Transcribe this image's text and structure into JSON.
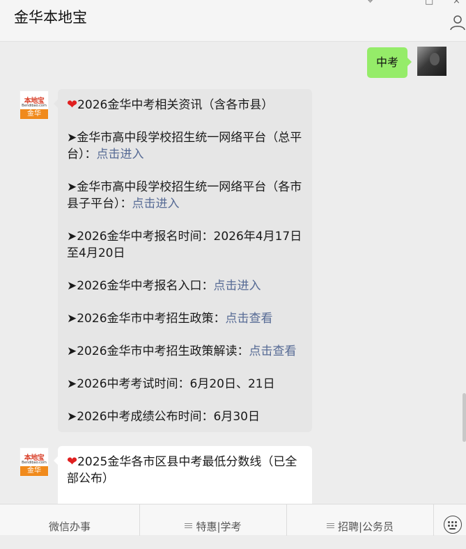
{
  "header": {
    "title": "金华本地宝",
    "pin_glyph": "⌖",
    "max_glyph": "□",
    "close_glyph": "×"
  },
  "messages": {
    "me": {
      "text": "中考"
    },
    "bot_avatar": {
      "top": "本地宝",
      "url": "Bendibao.com",
      "band": "金华"
    },
    "msg1": {
      "heart": "❤",
      "title": "2026金华中考相关资讯（含各市县）",
      "line1_text": "➤金华市高中段学校招生统一网络平台（总平台）：",
      "line1_link": "点击进入",
      "line2_text": "➤金华市高中段学校招生统一网络平台（各市县子平台）：",
      "line2_link": "点击进入",
      "line3_text": "➤2026金华中考报名时间：2026年4月17日至4月20日",
      "line4_text": "➤2026金华中考报名入口：",
      "line4_link": "点击进入",
      "line5_text": "➤2026金华市中考招生政策：",
      "line5_link": "点击查看",
      "line6_text": "➤2026金华市中考招生政策解读：",
      "line6_link": "点击查看",
      "line7_text": "➤2026中考考试时间：6月20日、21日",
      "line8_text": "➤2026中考成绩公布时间：6月30日"
    },
    "msg2": {
      "heart": "❤",
      "title": "2025金华各市区县中考最低分数线（已全部公布）"
    }
  },
  "bottom_menu": {
    "tab1": "微信办事",
    "tab2": "特惠|学考",
    "tab3": "招聘|公务员"
  },
  "icons": {
    "profile": "person-icon",
    "keyboard": "keyboard-icon",
    "menu": "hamburger-icon"
  },
  "colors": {
    "my_bubble": "#95ec69",
    "link": "#576b95",
    "heart": "#e02020",
    "logo_orange": "#f08a1c"
  }
}
